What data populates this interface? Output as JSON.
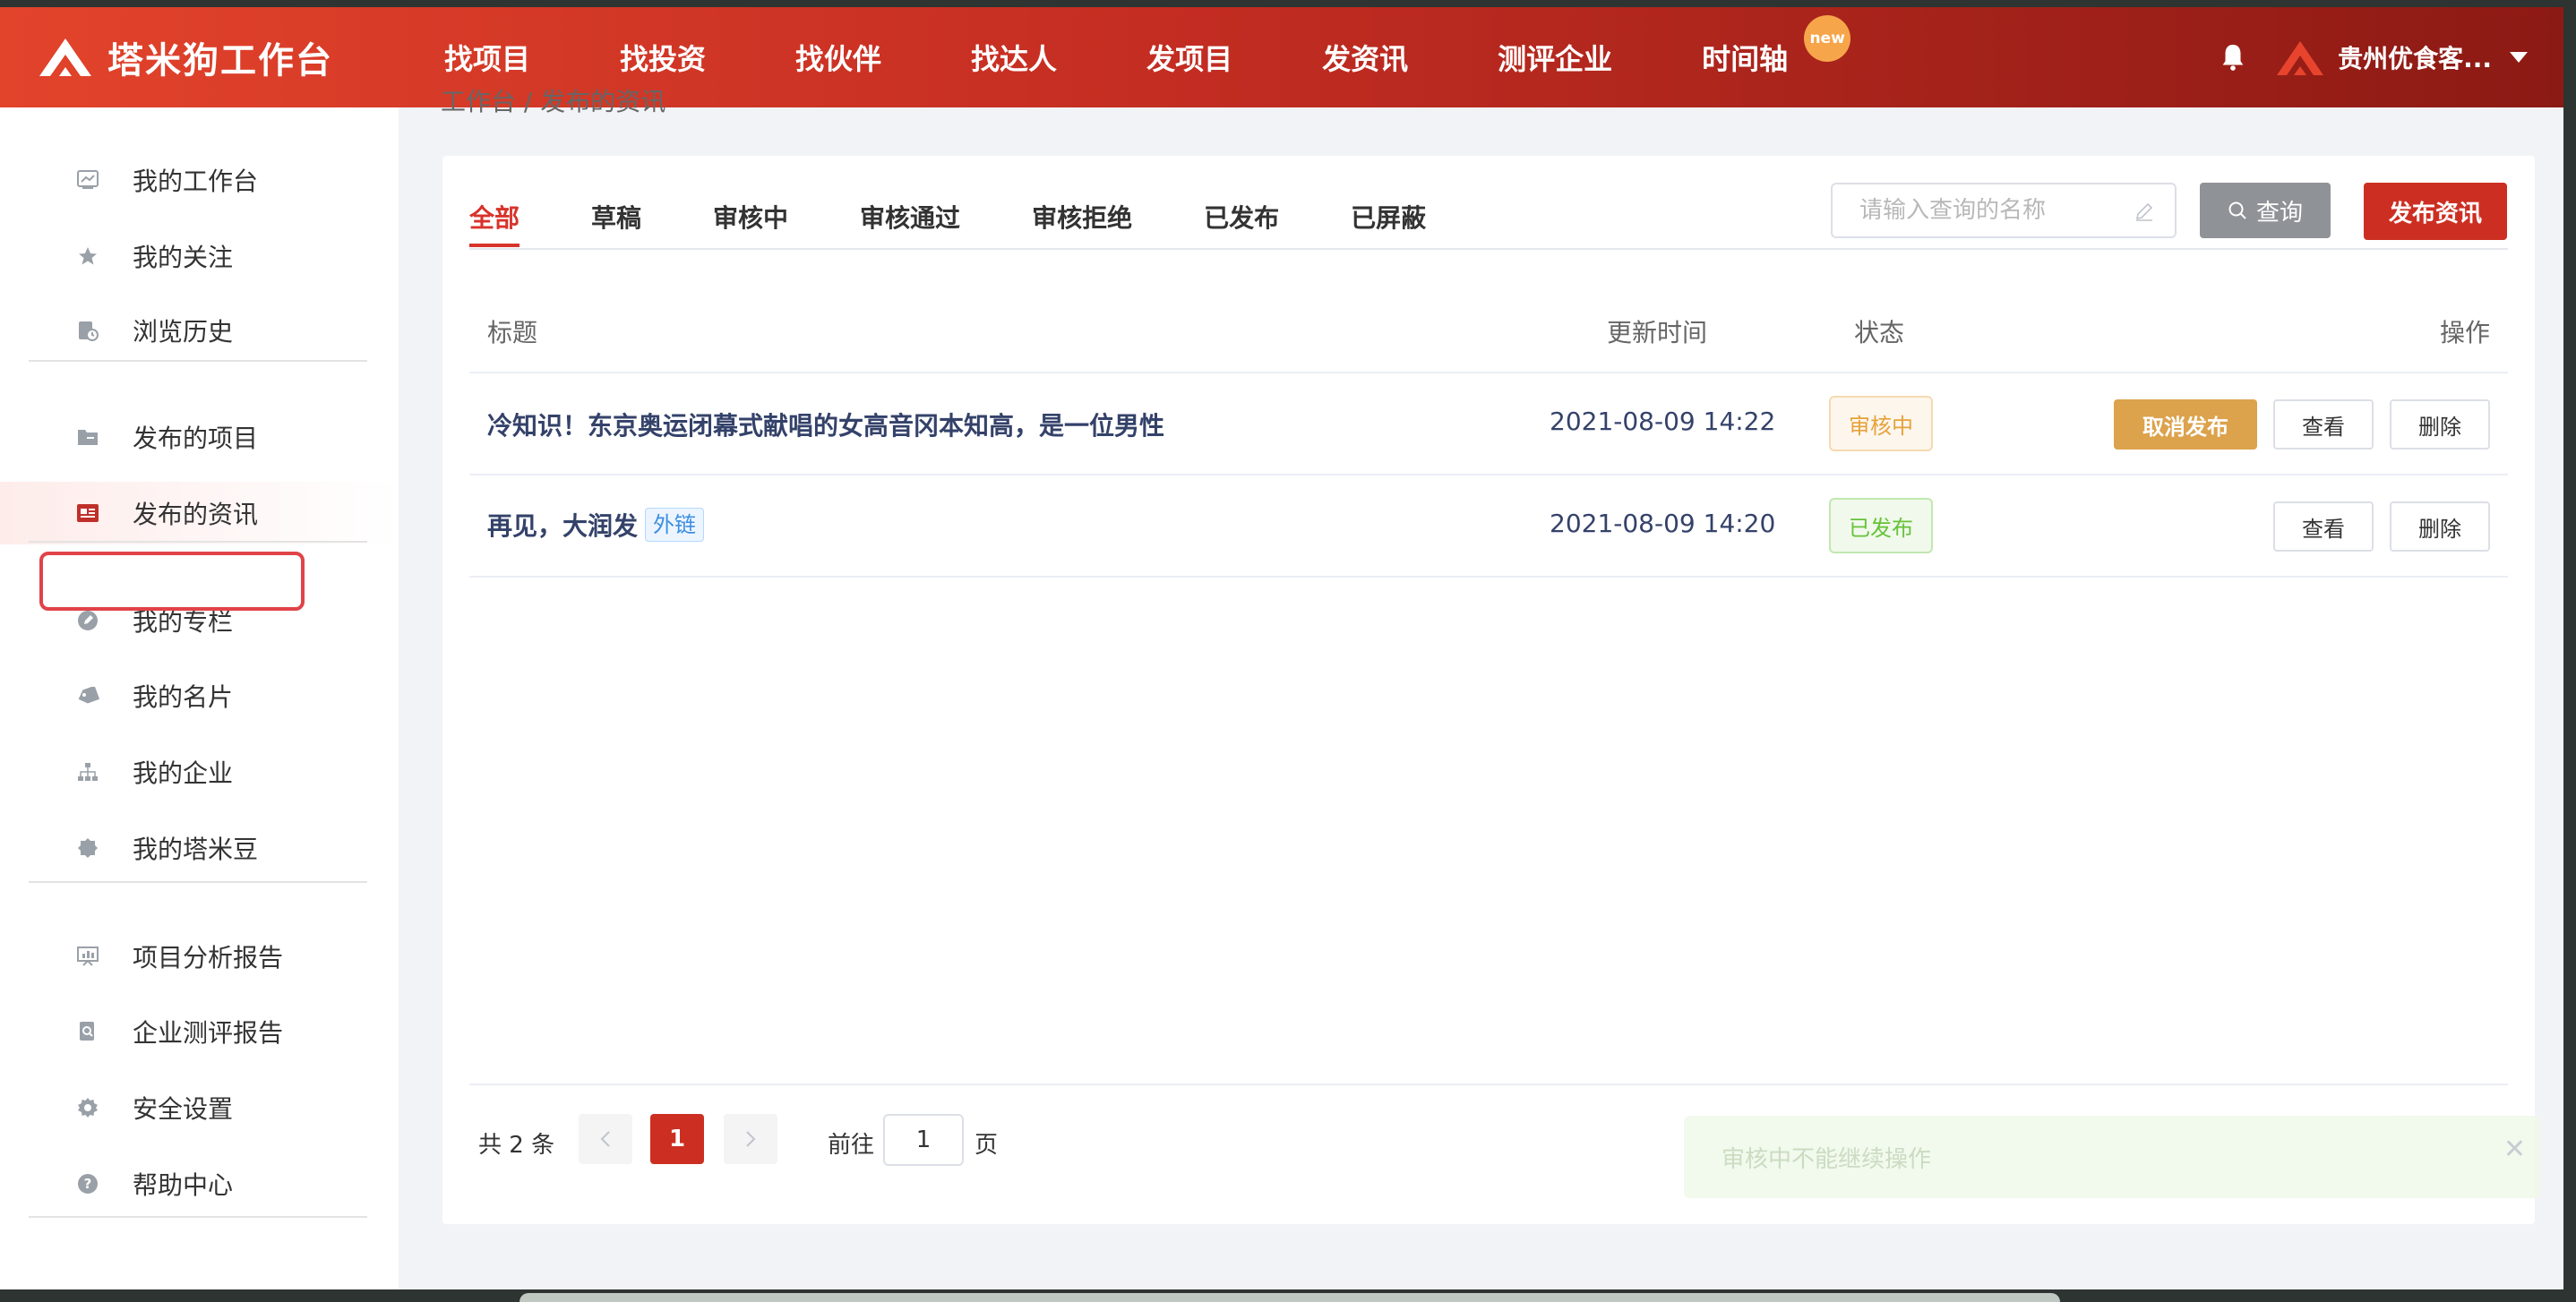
{
  "brand": {
    "name": "塔米狗工作台"
  },
  "nav": {
    "items": [
      "找项目",
      "找投资",
      "找伙伴",
      "找达人",
      "发项目",
      "发资讯",
      "测评企业"
    ],
    "timeline": "时间轴",
    "new_badge": "new"
  },
  "user": {
    "name": "贵州优食客..."
  },
  "sidebar": {
    "items": [
      {
        "label": "我的工作台",
        "icon": "dashboard-icon"
      },
      {
        "label": "我的关注",
        "icon": "star-icon"
      },
      {
        "label": "浏览历史",
        "icon": "history-icon"
      },
      {
        "label": "发布的项目",
        "icon": "folder-icon"
      },
      {
        "label": "发布的资讯",
        "icon": "news-icon"
      },
      {
        "label": "我的专栏",
        "icon": "pen-icon"
      },
      {
        "label": "我的名片",
        "icon": "tag-icon"
      },
      {
        "label": "我的企业",
        "icon": "org-icon"
      },
      {
        "label": "我的塔米豆",
        "icon": "bean-icon"
      },
      {
        "label": "项目分析报告",
        "icon": "report-icon"
      },
      {
        "label": "企业测评报告",
        "icon": "search-doc-icon"
      },
      {
        "label": "安全设置",
        "icon": "gear-icon"
      },
      {
        "label": "帮助中心",
        "icon": "help-icon"
      }
    ],
    "active": "发布的资讯"
  },
  "breadcrumb": "工作台 / 发布的资讯",
  "tabs": [
    "全部",
    "草稿",
    "审核中",
    "审核通过",
    "审核拒绝",
    "已发布",
    "已屏蔽"
  ],
  "active_tab": "全部",
  "search": {
    "placeholder": "请输入查询的名称",
    "query_label": "查询",
    "publish_label": "发布资讯"
  },
  "table": {
    "headers": {
      "title": "标题",
      "updated": "更新时间",
      "status": "状态",
      "actions": "操作"
    },
    "rows": [
      {
        "title": "冷知识！东京奥运闭幕式献唱的女高音冈本知高，是一位男性",
        "tag": "",
        "updated": "2021-08-09 14:22",
        "status": "审核中",
        "actions": [
          "取消发布",
          "查看",
          "删除"
        ]
      },
      {
        "title": "再见，大润发",
        "tag": "外链",
        "updated": "2021-08-09 14:20",
        "status": "已发布",
        "actions": [
          "查看",
          "删除"
        ]
      }
    ]
  },
  "pagination": {
    "total": "共 2 条",
    "current": "1",
    "goto_label": "前往",
    "goto_value": "1",
    "page_label": "页"
  },
  "toast": {
    "message": "审核中不能继续操作",
    "close": "✕"
  },
  "colors": {
    "brand_red": "#cc2f22",
    "warning": "#e6a23c",
    "success": "#67c23a"
  }
}
